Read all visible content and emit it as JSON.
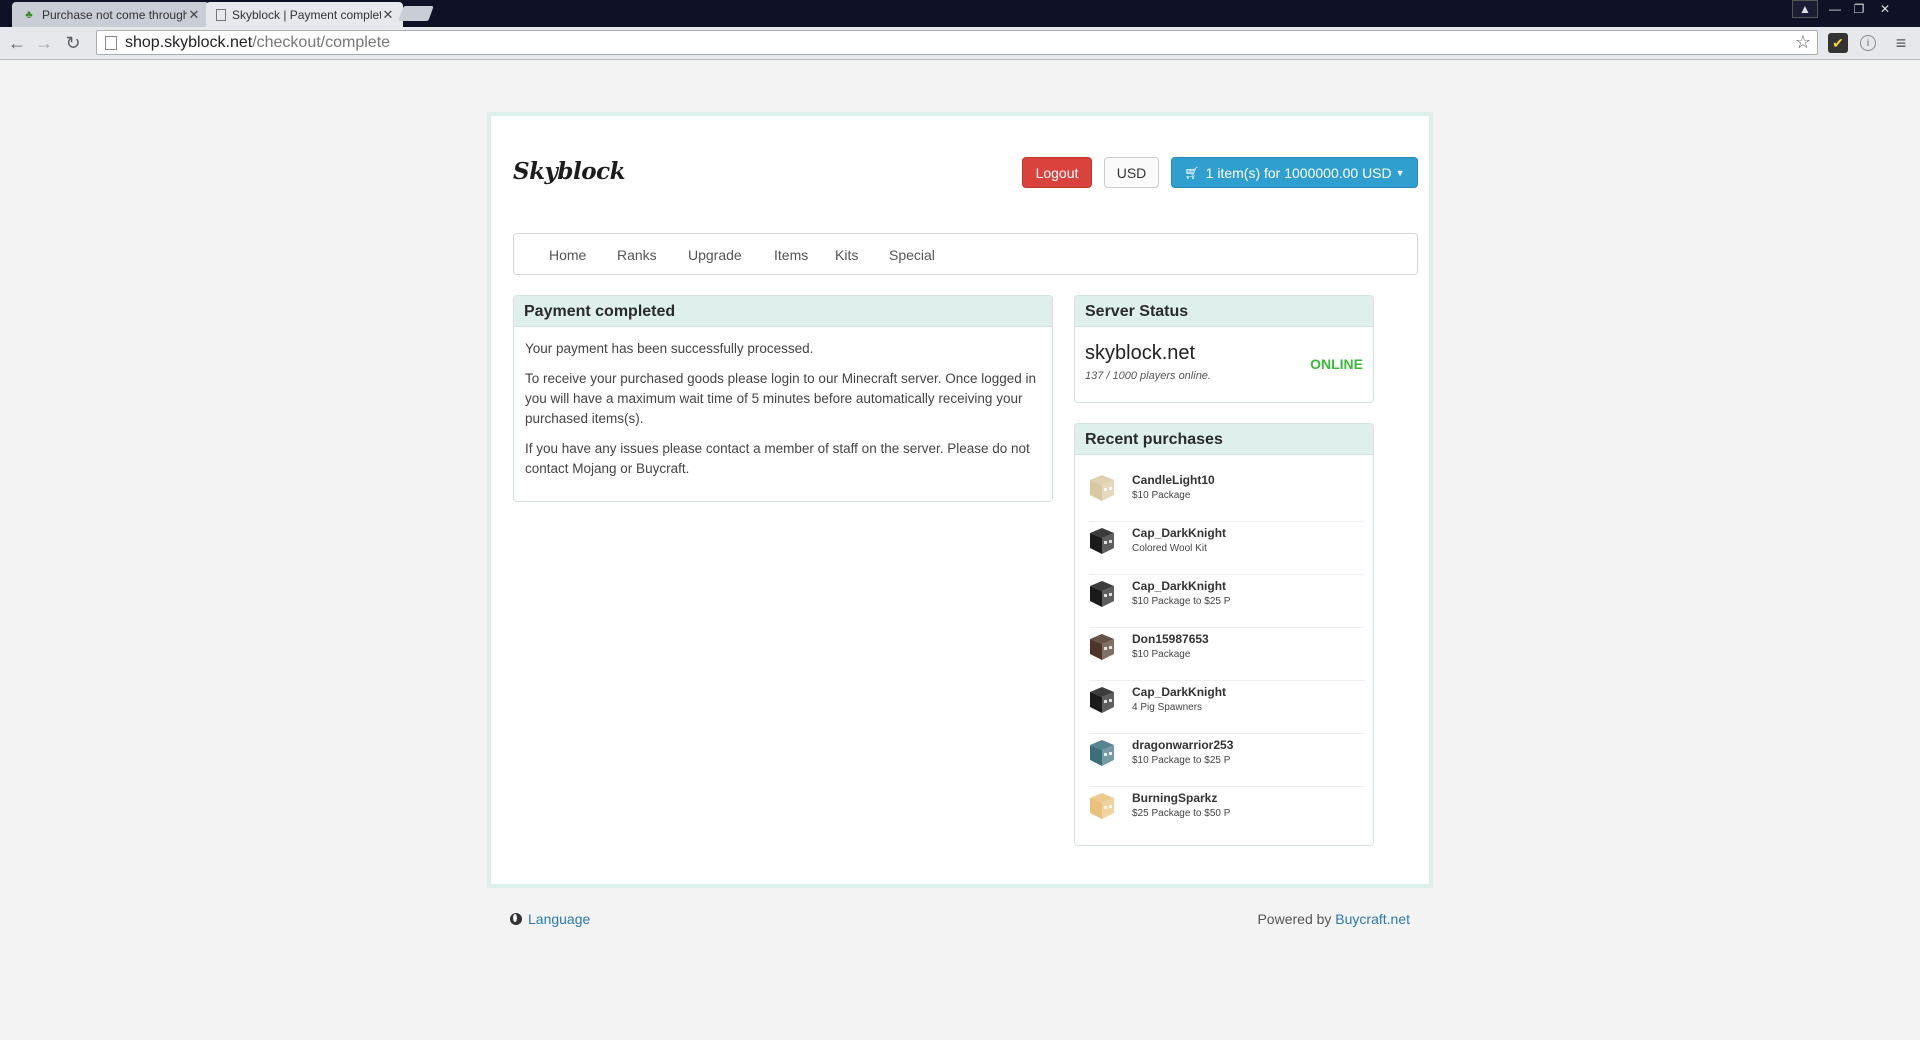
{
  "browser": {
    "tabs": [
      {
        "title": "Purchase not come through",
        "active": false
      },
      {
        "title": "Skyblock | Payment complete",
        "active": true
      }
    ],
    "url_host": "shop.skyblock.net",
    "url_path": "/checkout/complete"
  },
  "header": {
    "logo": "Skyblock",
    "logout_label": "Logout",
    "currency_label": "USD",
    "cart_label": "1 item(s) for 1000000.00 USD"
  },
  "nav": [
    "Home",
    "Ranks",
    "Upgrade",
    "Items",
    "Kits",
    "Special"
  ],
  "payment": {
    "title": "Payment completed",
    "paragraphs": [
      "Your payment has been successfully processed.",
      "To receive your purchased goods please login to our Minecraft server. Once logged in you will have a maximum wait time of 5 minutes before automatically receiving your purchased items(s).",
      "If you have any issues please contact a member of staff on the server. Please do not contact Mojang or Buycraft."
    ]
  },
  "server_status": {
    "title": "Server Status",
    "name": "skyblock.net",
    "players": "137 / 1000 players online.",
    "state": "ONLINE"
  },
  "recent": {
    "title": "Recent purchases",
    "items": [
      {
        "name": "CandleLight10",
        "package": "$10 Package",
        "skin": "#d9c9a3"
      },
      {
        "name": "Cap_DarkKnight",
        "package": "Colored Wool Kit",
        "skin": "#1a1a1a"
      },
      {
        "name": "Cap_DarkKnight",
        "package": "$10 Package to $25 P",
        "skin": "#1a1a1a"
      },
      {
        "name": "Don15987653",
        "package": "$10 Package",
        "skin": "#4a3526"
      },
      {
        "name": "Cap_DarkKnight",
        "package": "4 Pig Spawners",
        "skin": "#1a1a1a"
      },
      {
        "name": "dragonwarrior253",
        "package": "$10 Package to $25 P",
        "skin": "#3a6f7a"
      },
      {
        "name": "BurningSparkz",
        "package": "$25 Package to $50 P",
        "skin": "#e8c27a"
      }
    ]
  },
  "footer": {
    "language_label": "Language",
    "powered_prefix": "Powered by ",
    "powered_link": "Buycraft.net"
  }
}
